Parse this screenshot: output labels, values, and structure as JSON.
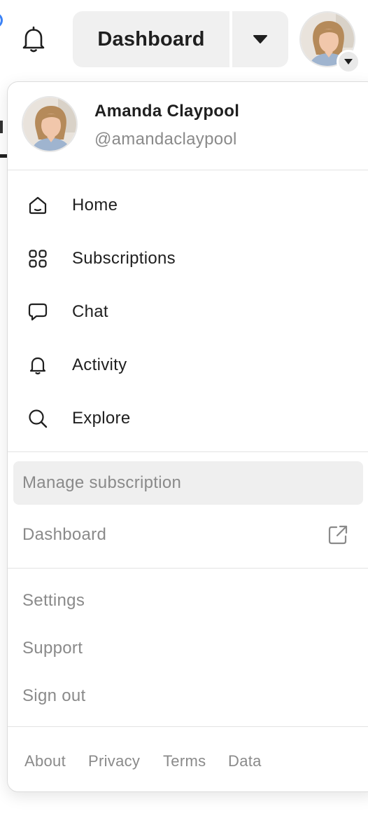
{
  "topbar": {
    "dashboard_label": "Dashboard"
  },
  "profile": {
    "name": "Amanda Claypool",
    "handle": "@amandaclaypool"
  },
  "nav": {
    "items": [
      {
        "label": "Home",
        "icon": "home-icon"
      },
      {
        "label": "Subscriptions",
        "icon": "grid-icon"
      },
      {
        "label": "Chat",
        "icon": "chat-bubble-icon"
      },
      {
        "label": "Activity",
        "icon": "bell-icon"
      },
      {
        "label": "Explore",
        "icon": "search-icon"
      }
    ]
  },
  "secondary": {
    "manage_subscription": "Manage subscription",
    "dashboard": "Dashboard"
  },
  "account": {
    "settings": "Settings",
    "support": "Support",
    "sign_out": "Sign out"
  },
  "footer": {
    "about": "About",
    "privacy": "Privacy",
    "terms": "Terms",
    "data": "Data"
  },
  "colors": {
    "button_bg": "#f0f0f0",
    "muted_text": "#8a8a8a",
    "active_row": "#efefef",
    "notification_accent": "#3b82f6"
  }
}
